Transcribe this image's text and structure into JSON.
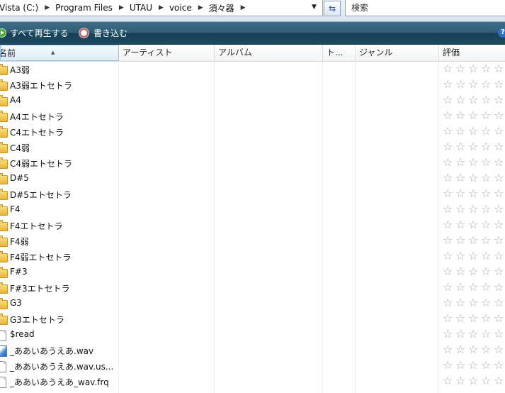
{
  "address_bar": {
    "crumbs": [
      "Vista (C:)",
      "Program Files",
      "UTAU",
      "voice",
      "須々器"
    ],
    "dropdown_icon": "chevron-down-icon",
    "refresh_icon": "refresh-icon"
  },
  "search": {
    "placeholder": "検索"
  },
  "toolbar": {
    "play_all_label": "すべて再生する",
    "burn_label": "書き込む",
    "help_glyph": "?"
  },
  "columns": {
    "name": "名前",
    "artist": "アーティスト",
    "album": "アルバム",
    "track": "ト...",
    "genre": "ジャンル",
    "rating": "評価"
  },
  "rating_glyph": "☆",
  "files": [
    {
      "name": "A3弱",
      "type": "folder"
    },
    {
      "name": "A3弱エトセトラ",
      "type": "folder"
    },
    {
      "name": "A4",
      "type": "folder"
    },
    {
      "name": "A4エトセトラ",
      "type": "folder"
    },
    {
      "name": "C4エトセトラ",
      "type": "folder"
    },
    {
      "name": "C4弱",
      "type": "folder"
    },
    {
      "name": "C4弱エトセトラ",
      "type": "folder"
    },
    {
      "name": "D#5",
      "type": "folder"
    },
    {
      "name": "D#5エトセトラ",
      "type": "folder"
    },
    {
      "name": "F4",
      "type": "folder"
    },
    {
      "name": "F4エトセトラ",
      "type": "folder"
    },
    {
      "name": "F4弱",
      "type": "folder"
    },
    {
      "name": "F4弱エトセトラ",
      "type": "folder"
    },
    {
      "name": "F#3",
      "type": "folder"
    },
    {
      "name": "F#3エトセトラ",
      "type": "folder"
    },
    {
      "name": "G3",
      "type": "folder"
    },
    {
      "name": "G3エトセトラ",
      "type": "folder"
    },
    {
      "name": "$read",
      "type": "file"
    },
    {
      "name": "_ああいあうえあ.wav",
      "type": "wav"
    },
    {
      "name": "_ああいあうえあ.wav.us...",
      "type": "file"
    },
    {
      "name": "_ああいあうえあ_wav.frq",
      "type": "file"
    }
  ]
}
